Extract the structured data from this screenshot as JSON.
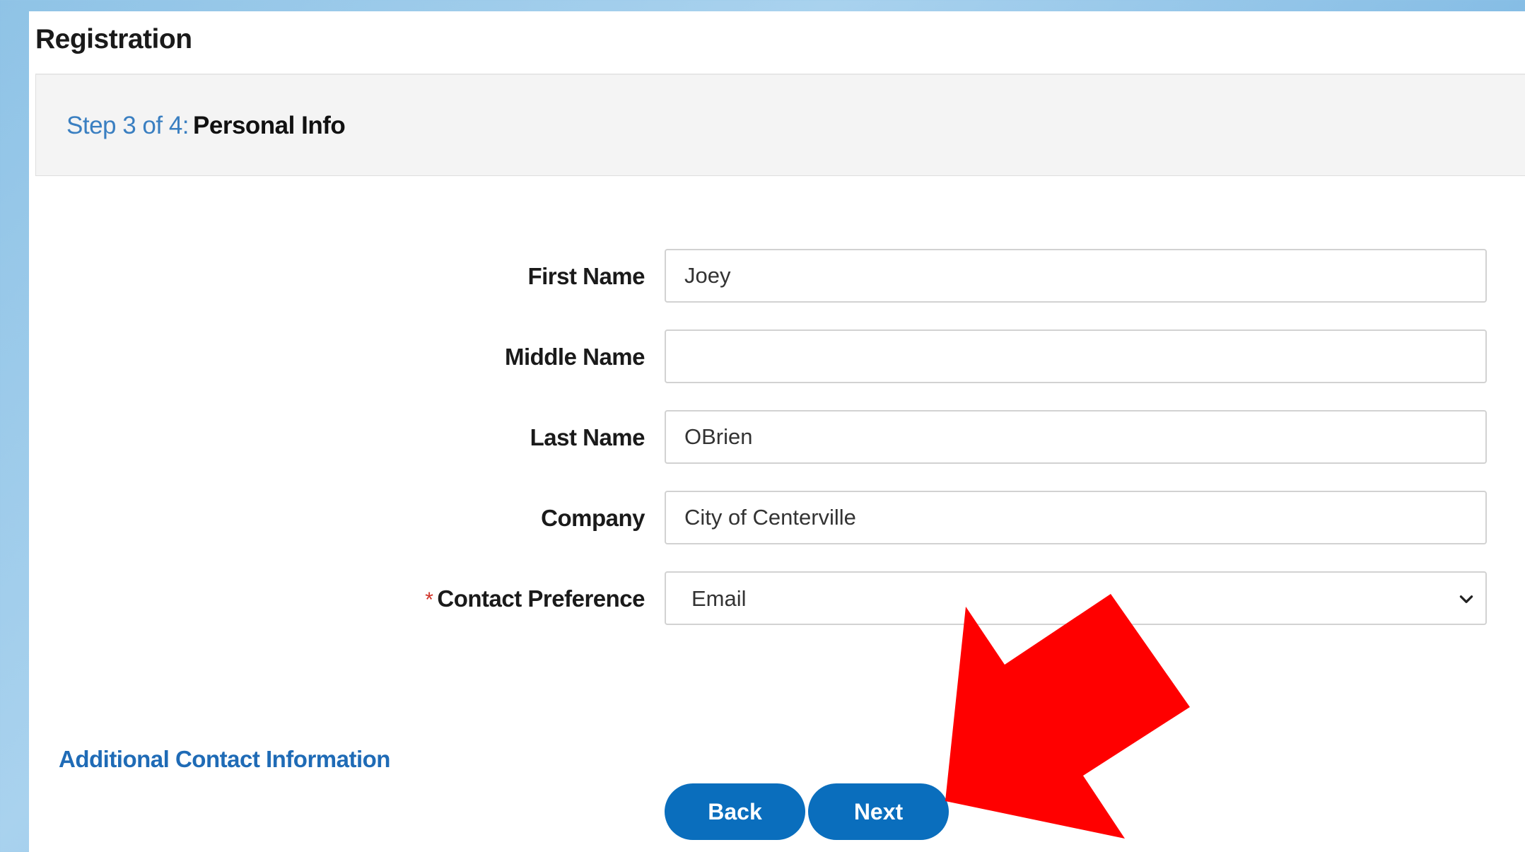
{
  "page": {
    "title": "Registration"
  },
  "step": {
    "number": "Step 3 of 4:",
    "name": "Personal Info"
  },
  "form": {
    "first_name": {
      "label": "First Name",
      "value": "Joey"
    },
    "middle_name": {
      "label": "Middle Name",
      "value": ""
    },
    "last_name": {
      "label": "Last Name",
      "value": "OBrien"
    },
    "company": {
      "label": "Company",
      "value": "City of Centerville"
    },
    "contact_preference": {
      "required_mark": "*",
      "label": "Contact Preference",
      "selected": "Email"
    }
  },
  "links": {
    "additional_contact": "Additional Contact Information"
  },
  "buttons": {
    "back": "Back",
    "next": "Next"
  },
  "annotation": {
    "arrow_color": "#ff0000"
  },
  "colors": {
    "accent": "#0a6ebd",
    "link": "#1f6bb6",
    "step_number": "#3a7fc1",
    "required": "#d0352b"
  },
  "icons": {
    "select": "chevron-down-icon"
  }
}
